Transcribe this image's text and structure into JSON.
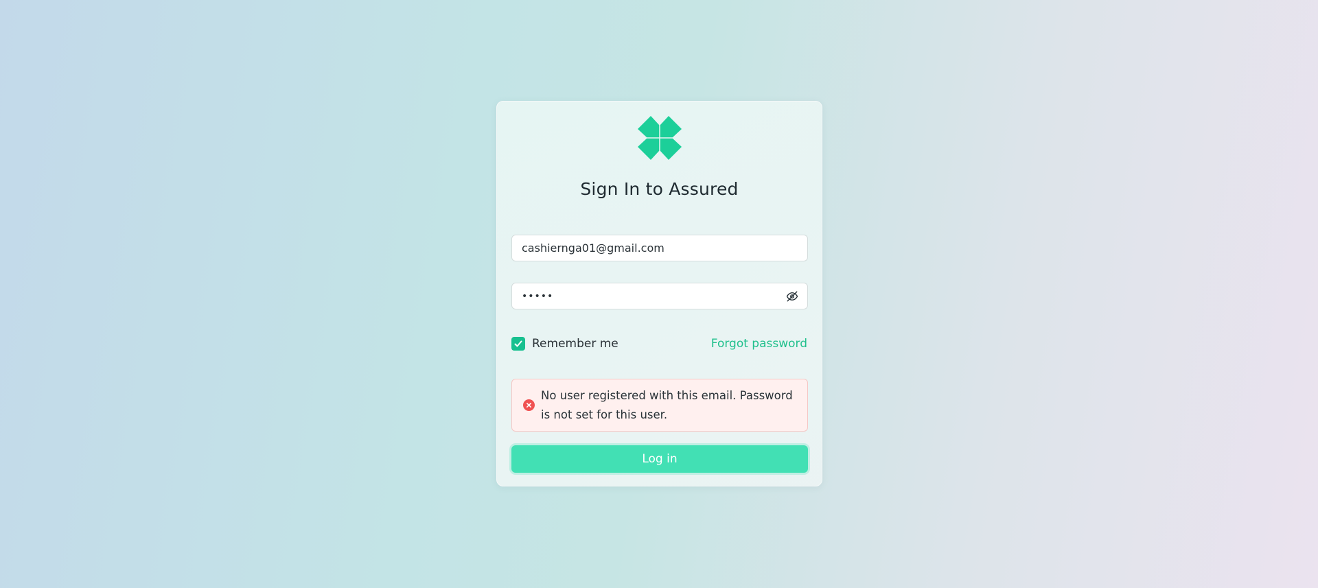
{
  "login": {
    "title": "Sign In to Assured",
    "email_value": "cashiernga01@gmail.com",
    "password_value": "•••••",
    "remember_label": "Remember me",
    "remember_checked": true,
    "forgot_label": "Forgot password",
    "error_message": "No user registered with this email. Password is not set for this user.",
    "login_button": "Log in"
  },
  "icons": {
    "logo": "assured-logo",
    "eye": "eye-slash-icon",
    "check": "check-icon",
    "error": "error-circle-icon"
  },
  "colors": {
    "brand": "#1ccf99",
    "button": "#42e0b4",
    "link": "#20c08c",
    "error": "#f05252",
    "error_bg": "#fff0ef"
  }
}
